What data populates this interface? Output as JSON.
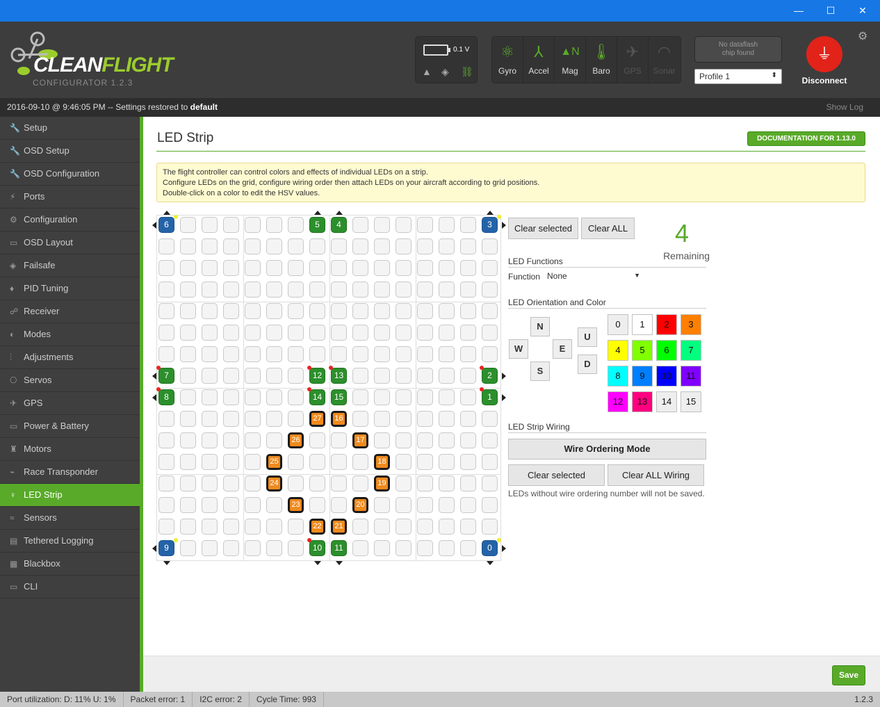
{
  "window": {
    "minimize": "—",
    "maximize": "☐",
    "close": "✕"
  },
  "logo": {
    "brand_a": "CLEAN",
    "brand_b": "FLIGHT",
    "version": "CONFIGURATOR  1.2.3"
  },
  "battery": {
    "voltage": "0.1 V"
  },
  "sensors": [
    {
      "label": "Gyro",
      "active": true
    },
    {
      "label": "Accel",
      "active": true
    },
    {
      "label": "Mag",
      "active": true
    },
    {
      "label": "Baro",
      "active": true
    },
    {
      "label": "GPS",
      "active": false
    },
    {
      "label": "Sonar",
      "active": false
    }
  ],
  "dataflash": {
    "line1": "No dataflash",
    "line2": "chip found"
  },
  "profile": {
    "selected": "Profile 1"
  },
  "connect": {
    "label": "Disconnect"
  },
  "log": {
    "prefix": "2016-09-10 @ 9:46:05 PM -- Settings restored to ",
    "bold": "default",
    "show_log": "Show Log"
  },
  "sidebar": [
    {
      "label": "Setup",
      "icon": "wrench"
    },
    {
      "label": "OSD Setup",
      "icon": "wrench"
    },
    {
      "label": "OSD Configuration",
      "icon": "wrench"
    },
    {
      "label": "Ports",
      "icon": "plug"
    },
    {
      "label": "Configuration",
      "icon": "gear"
    },
    {
      "label": "OSD Layout",
      "icon": "osd"
    },
    {
      "label": "Failsafe",
      "icon": "parachute"
    },
    {
      "label": "PID Tuning",
      "icon": "pid"
    },
    {
      "label": "Receiver",
      "icon": "receiver"
    },
    {
      "label": "Modes",
      "icon": "modes"
    },
    {
      "label": "Adjustments",
      "icon": "sliders"
    },
    {
      "label": "Servos",
      "icon": "servo"
    },
    {
      "label": "GPS",
      "icon": "satellite"
    },
    {
      "label": "Power & Battery",
      "icon": "battery"
    },
    {
      "label": "Motors",
      "icon": "motor"
    },
    {
      "label": "Race Transponder",
      "icon": "transponder"
    },
    {
      "label": "LED Strip",
      "icon": "led",
      "active": true
    },
    {
      "label": "Sensors",
      "icon": "sensors"
    },
    {
      "label": "Tethered Logging",
      "icon": "logging"
    },
    {
      "label": "Blackbox",
      "icon": "blackbox"
    },
    {
      "label": "CLI",
      "icon": "cli"
    }
  ],
  "page": {
    "title": "LED Strip",
    "doc_button": "DOCUMENTATION FOR 1.13.0",
    "note": [
      "The flight controller can control colors and effects of individual LEDs on a strip.",
      "Configure LEDs on the grid, configure wiring order then attach LEDs on your aircraft according to grid positions.",
      "Double-click on a color to edit the HSV values."
    ]
  },
  "grid_leds": [
    {
      "row": 0,
      "col": 0,
      "label": "6",
      "color": "blue"
    },
    {
      "row": 0,
      "col": 7,
      "label": "5",
      "color": "green"
    },
    {
      "row": 0,
      "col": 8,
      "label": "4",
      "color": "green"
    },
    {
      "row": 0,
      "col": 15,
      "label": "3",
      "color": "blue"
    },
    {
      "row": 7,
      "col": 0,
      "label": "7",
      "color": "green"
    },
    {
      "row": 7,
      "col": 7,
      "label": "12",
      "color": "green"
    },
    {
      "row": 7,
      "col": 8,
      "label": "13",
      "color": "green"
    },
    {
      "row": 7,
      "col": 15,
      "label": "2",
      "color": "green"
    },
    {
      "row": 8,
      "col": 0,
      "label": "8",
      "color": "green"
    },
    {
      "row": 8,
      "col": 7,
      "label": "14",
      "color": "green"
    },
    {
      "row": 8,
      "col": 8,
      "label": "15",
      "color": "green"
    },
    {
      "row": 8,
      "col": 15,
      "label": "1",
      "color": "green"
    },
    {
      "row": 9,
      "col": 7,
      "label": "27",
      "color": "orange"
    },
    {
      "row": 9,
      "col": 8,
      "label": "16",
      "color": "orange"
    },
    {
      "row": 10,
      "col": 6,
      "label": "26",
      "color": "orange"
    },
    {
      "row": 10,
      "col": 9,
      "label": "17",
      "color": "orange"
    },
    {
      "row": 11,
      "col": 5,
      "label": "25",
      "color": "orange"
    },
    {
      "row": 11,
      "col": 10,
      "label": "18",
      "color": "orange"
    },
    {
      "row": 12,
      "col": 5,
      "label": "24",
      "color": "orange"
    },
    {
      "row": 12,
      "col": 10,
      "label": "19",
      "color": "orange"
    },
    {
      "row": 13,
      "col": 6,
      "label": "23",
      "color": "orange"
    },
    {
      "row": 13,
      "col": 9,
      "label": "20",
      "color": "orange"
    },
    {
      "row": 14,
      "col": 7,
      "label": "22",
      "color": "orange"
    },
    {
      "row": 14,
      "col": 8,
      "label": "21",
      "color": "orange"
    },
    {
      "row": 15,
      "col": 0,
      "label": "9",
      "color": "blue"
    },
    {
      "row": 15,
      "col": 7,
      "label": "10",
      "color": "green"
    },
    {
      "row": 15,
      "col": 8,
      "label": "11",
      "color": "green"
    },
    {
      "row": 15,
      "col": 15,
      "label": "0",
      "color": "blue"
    }
  ],
  "controls": {
    "clear_selected": "Clear selected",
    "clear_all": "Clear ALL",
    "remaining_count": "4",
    "remaining_label": "Remaining",
    "led_functions": "LED Functions",
    "function_label": "Function",
    "function_value": "None",
    "orientation_heading": "LED Orientation and Color",
    "directions": {
      "n": "N",
      "e": "E",
      "s": "S",
      "w": "W",
      "u": "U",
      "d": "D"
    },
    "colors": [
      {
        "label": "0",
        "hex": "#eeeeee"
      },
      {
        "label": "1",
        "hex": "#ffffff"
      },
      {
        "label": "2",
        "hex": "#ff0000"
      },
      {
        "label": "3",
        "hex": "#ff7f00"
      },
      {
        "label": "4",
        "hex": "#ffff00"
      },
      {
        "label": "5",
        "hex": "#7fff00"
      },
      {
        "label": "6",
        "hex": "#00ff00"
      },
      {
        "label": "7",
        "hex": "#00ff7f"
      },
      {
        "label": "8",
        "hex": "#00ffff"
      },
      {
        "label": "9",
        "hex": "#007fff"
      },
      {
        "label": "10",
        "hex": "#0000ff"
      },
      {
        "label": "11",
        "hex": "#7f00ff"
      },
      {
        "label": "12",
        "hex": "#ff00ff"
      },
      {
        "label": "13",
        "hex": "#ff007f"
      },
      {
        "label": "14",
        "hex": "#eeeeee"
      },
      {
        "label": "15",
        "hex": "#eeeeee"
      }
    ],
    "wiring_heading": "LED Strip Wiring",
    "wire_ordering": "Wire Ordering Mode",
    "wire_clear_selected": "Clear selected",
    "wire_clear_all": "Clear ALL Wiring",
    "wire_note": "LEDs without wire ordering number will not be saved."
  },
  "footer": {
    "save": "Save"
  },
  "status": {
    "port": "Port utilization: D: 11% U: 1%",
    "packet": "Packet error: 1",
    "i2c": "I2C error: 2",
    "cycle": "Cycle Time: 993",
    "version": "1.2.3"
  },
  "colors": {
    "accent": "#59aa29",
    "header": "#3d3d3d",
    "sidebar": "#3f3f3f",
    "titlebar": "#1777e4",
    "disconnect": "#e2231a"
  }
}
